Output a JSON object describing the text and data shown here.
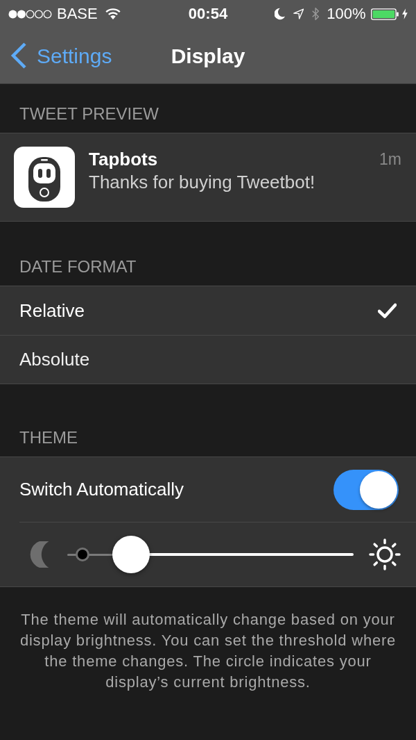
{
  "status_bar": {
    "carrier": "BASE",
    "time": "00:54",
    "battery": "100%"
  },
  "nav_bar": {
    "back": "Settings",
    "title": "Display"
  },
  "sections": [
    {
      "kind": "preview",
      "header": "TWEET PREVIEW",
      "tweet": {
        "name": "Tapbots",
        "text": "Thanks for buying Tweetbot!",
        "time": "1m"
      }
    },
    {
      "kind": "options",
      "header": "DATE FORMAT",
      "options": [
        {
          "label": "Relative",
          "selected": true
        },
        {
          "label": "Absolute",
          "selected": false
        }
      ]
    },
    {
      "kind": "theme",
      "header": "THEME",
      "toggle": {
        "label": "Switch Automatically",
        "on": true
      },
      "slider": {
        "level": 0.18,
        "indicator": {
          "level": 0.03
        }
      },
      "footer": "The theme will automatically change based on your display brightness. You can set the threshold where the theme changes. The circle indicates your display’s current brightness."
    }
  ]
}
